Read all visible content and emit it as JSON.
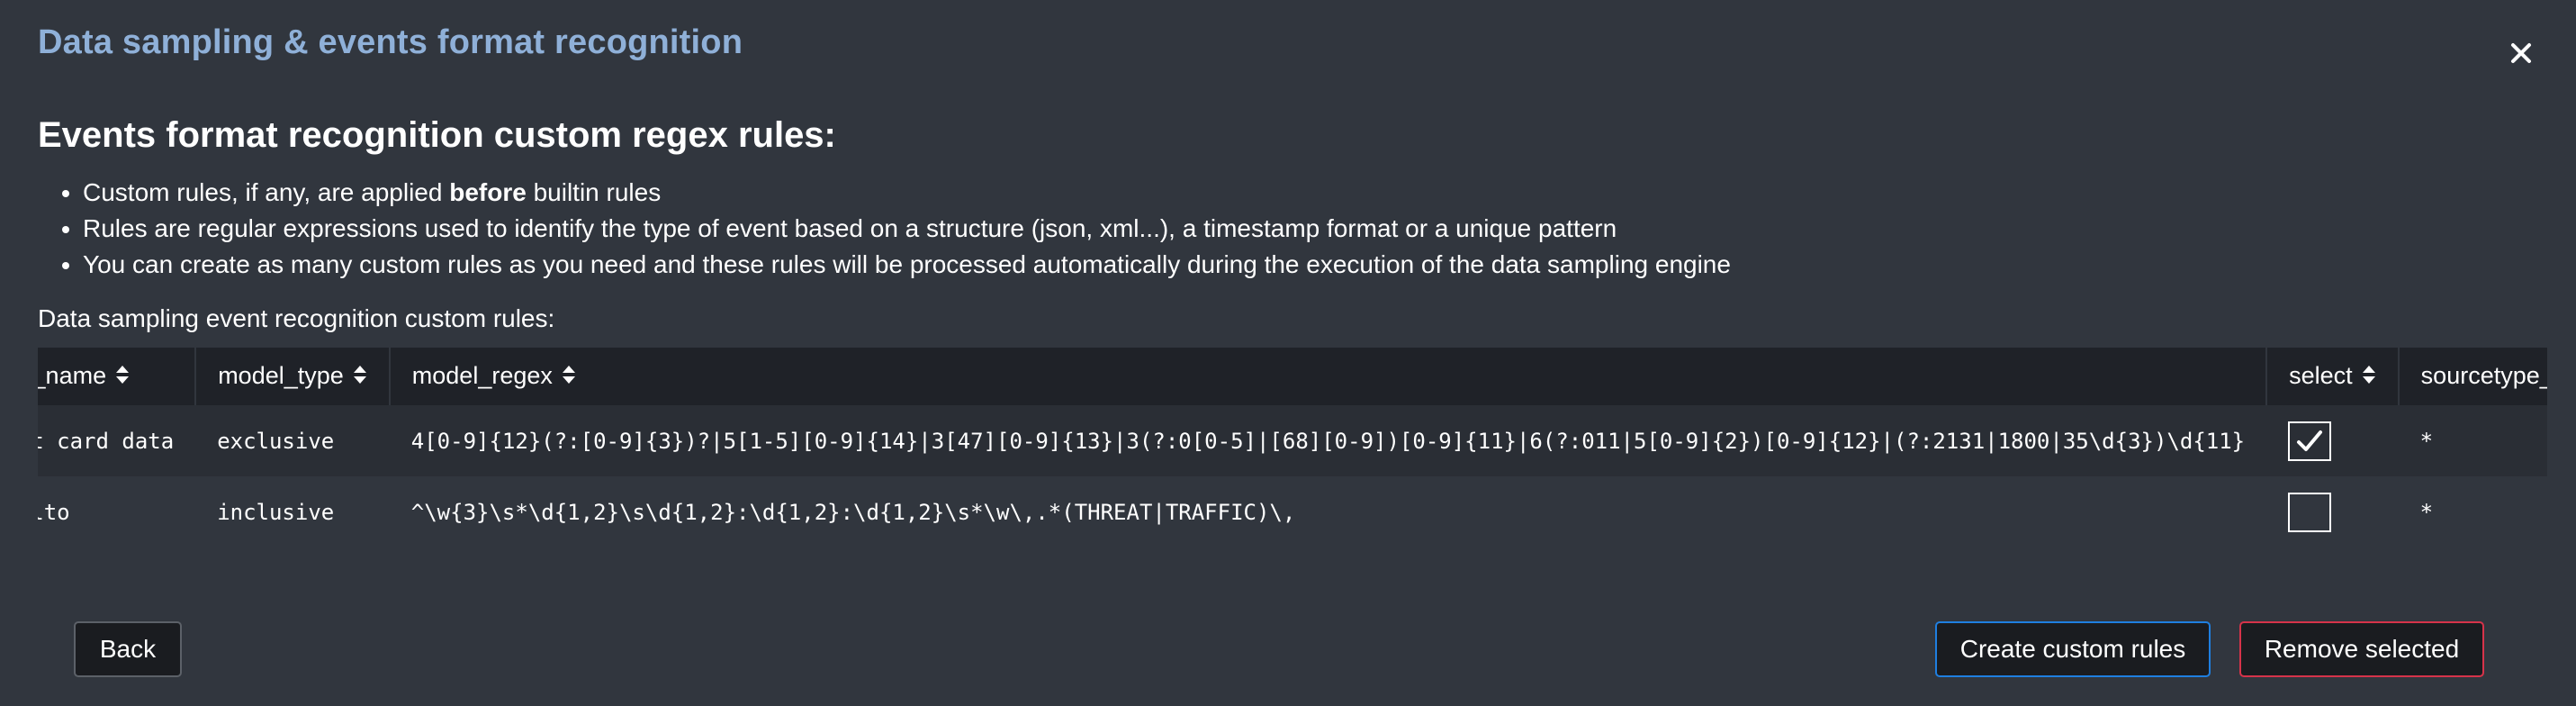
{
  "modal": {
    "title": "Data sampling & events format recognition",
    "close_icon": "close-icon"
  },
  "section": {
    "heading": "Events format recognition custom regex rules:",
    "bullets": [
      {
        "pre": "Custom rules, if any, are applied ",
        "bold": "before",
        "post": " builtin rules"
      },
      {
        "pre": "Rules are regular expressions used to identify the type of event based on a structure (json, xml...), a timestamp format or a unique pattern",
        "bold": "",
        "post": ""
      },
      {
        "pre": "You can create as many custom rules as you need and these rules will be processed automatically during the execution of the data sampling engine",
        "bold": "",
        "post": ""
      }
    ]
  },
  "table": {
    "caption": "Data sampling event recognition custom rules:",
    "columns": [
      "model_name",
      "model_type",
      "model_regex",
      "select",
      "sourcetype_scope"
    ],
    "sort_icon": "sort-icon",
    "rows": [
      {
        "model_name": "credit card data",
        "model_type": "exclusive",
        "model_regex": "4[0-9]{12}(?:[0-9]{3})?|5[1-5][0-9]{14}|3[47][0-9]{13}|3(?:0[0-5]|[68][0-9])[0-9]{11}|6(?:011|5[0-9]{2})[0-9]{12}|(?:2131|1800|35\\d{3})\\d{11}",
        "select": true,
        "sourcetype_scope": "*"
      },
      {
        "model_name": "paloalto",
        "model_type": "inclusive",
        "model_regex": "^\\w{3}\\s*\\d{1,2}\\s\\d{1,2}:\\d{1,2}:\\d{1,2}\\s*\\w\\,.*(THREAT|TRAFFIC)\\,",
        "select": false,
        "sourcetype_scope": "*"
      }
    ]
  },
  "buttons": {
    "back": "Back",
    "create": "Create custom rules",
    "remove": "Remove selected"
  },
  "colors": {
    "background": "#31363e",
    "title": "#8fb0d8",
    "header_bg": "#1f2228",
    "create_border": "#1f7fe0",
    "remove_border": "#d6334a"
  }
}
